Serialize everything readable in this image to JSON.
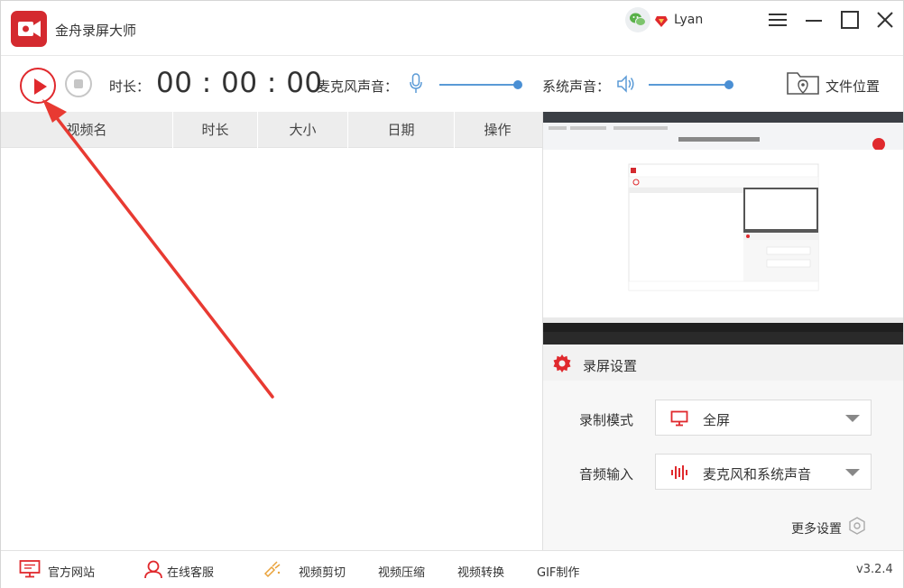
{
  "app": {
    "title": "金舟录屏大师",
    "username": "Lyan",
    "version": "v3.2.4"
  },
  "window_controls": {
    "menu_icon": "hamburger-icon",
    "minimize_icon": "minimize-icon",
    "maximize_icon": "maximize-icon",
    "close_icon": "close-icon"
  },
  "toolbar": {
    "duration_label": "时长：",
    "duration_value": "00 : 00 : 00",
    "mic_label": "麦克风声音：",
    "system_label": "系统声音：",
    "folder_label": "文件位置",
    "mic_volume_fraction": 1.0,
    "system_volume_fraction": 1.0
  },
  "list": {
    "columns": [
      "视频名",
      "时长",
      "大小",
      "日期",
      "操作"
    ],
    "rows": []
  },
  "settings": {
    "title": "录屏设置",
    "mode_label": "录制模式",
    "mode_value": "全屏",
    "audio_label": "音频输入",
    "audio_value": "麦克风和系统声音",
    "more_label": "更多设置"
  },
  "footer": {
    "items": [
      "官方网站",
      "在线客服",
      "视频剪切",
      "视频压缩",
      "视频转换",
      "GIF制作"
    ]
  },
  "colors": {
    "accent_red": "#e0292d",
    "slider_blue": "#4a8fd4"
  }
}
